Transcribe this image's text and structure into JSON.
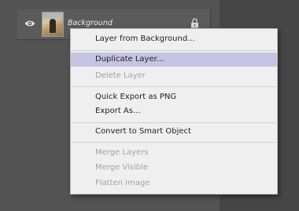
{
  "layers_panel": {
    "layer": {
      "name": "Background",
      "visibility_icon": "eye-icon",
      "lock_icon": "lock-icon",
      "thumbnail": "image-thumbnail"
    }
  },
  "context_menu": {
    "items": [
      {
        "label": "Layer from Background...",
        "enabled": true
      },
      {
        "label": "Duplicate Layer...",
        "enabled": true,
        "highlighted": true
      },
      {
        "label": "Delete Layer",
        "enabled": false
      },
      {
        "label": "Quick Export as PNG",
        "enabled": true
      },
      {
        "label": "Export As...",
        "enabled": true
      },
      {
        "label": "Convert to Smart Object",
        "enabled": true
      },
      {
        "label": "Merge Layers",
        "enabled": false
      },
      {
        "label": "Merge Visible",
        "enabled": false
      },
      {
        "label": "Flatten Image",
        "enabled": false
      }
    ],
    "highlight_color": "#c7c3e2"
  }
}
